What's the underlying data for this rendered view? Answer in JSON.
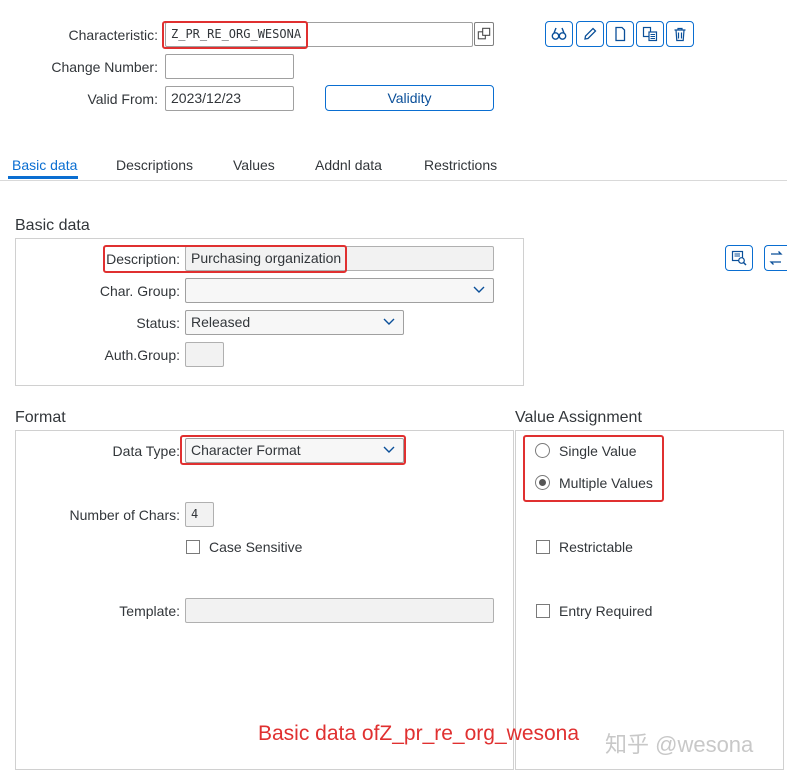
{
  "header": {
    "characteristic_label": "Characteristic:",
    "characteristic_value": "Z_PR_RE_ORG_WESONA",
    "change_number_label": "Change Number:",
    "change_number_value": "",
    "valid_from_label": "Valid From:",
    "valid_from_value": "2023/12/23",
    "validity_button": "Validity",
    "toolbar_icons": [
      "binoculars-icon",
      "pencil-icon",
      "document-icon",
      "copy-icon",
      "trash-icon"
    ]
  },
  "tabs": [
    {
      "label": "Basic data",
      "active": true
    },
    {
      "label": "Descriptions",
      "active": false
    },
    {
      "label": "Values",
      "active": false
    },
    {
      "label": "Addnl data",
      "active": false
    },
    {
      "label": "Restrictions",
      "active": false
    }
  ],
  "basic_data": {
    "title": "Basic data",
    "description_label": "Description:",
    "description_value": "Purchasing organization",
    "char_group_label": "Char. Group:",
    "char_group_value": "",
    "status_label": "Status:",
    "status_value": "Released",
    "auth_group_label": "Auth.Group:",
    "auth_group_value": ""
  },
  "format": {
    "title": "Format",
    "data_type_label": "Data Type:",
    "data_type_value": "Character Format",
    "num_chars_label": "Number of Chars:",
    "num_chars_value": "4",
    "case_sensitive_label": "Case Sensitive",
    "case_sensitive_checked": false,
    "template_label": "Template:",
    "template_value": ""
  },
  "value_assignment": {
    "title": "Value Assignment",
    "single_value_label": "Single Value",
    "multiple_values_label": "Multiple Values",
    "selected": "multiple",
    "restrictable_label": "Restrictable",
    "restrictable_checked": false,
    "entry_required_label": "Entry Required",
    "entry_required_checked": false
  },
  "annotation": {
    "caption": "Basic data ofZ_pr_re_org_wesona",
    "watermark": "知乎 @wesona"
  },
  "colors": {
    "accent": "#0a6ed1",
    "highlight": "#e03030"
  }
}
